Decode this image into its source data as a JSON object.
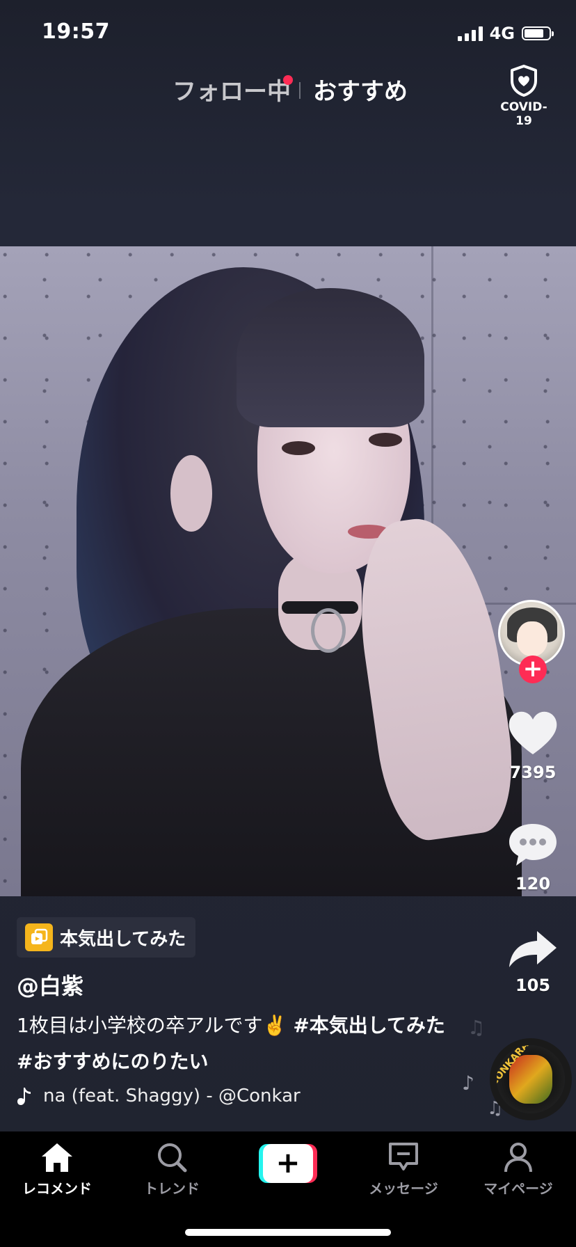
{
  "status_bar": {
    "time": "19:57",
    "network": "4G",
    "battery_level": 0.78
  },
  "top_tabs": {
    "following_label": "フォロー中",
    "foryou_label": "おすすめ",
    "following_has_new": true,
    "covid_label": "COVID-19"
  },
  "actions": {
    "likes": "7395",
    "comments": "120",
    "shares": "105"
  },
  "post": {
    "tag_chip_label": "本気出してみた",
    "username": "@白紫",
    "caption_text": "1枚目は小学校の卒アルです✌️ ",
    "hashtags": [
      "#本気出してみた",
      "#おすすめにのりたい"
    ],
    "music": "na (feat. Shaggy) - @Conkar",
    "disc_text": "CONKARAH"
  },
  "bottom_nav": {
    "items": [
      {
        "label": "レコメンド",
        "icon": "home-icon",
        "active": true
      },
      {
        "label": "トレンド",
        "icon": "search-icon",
        "active": false
      },
      {
        "label": "メッセージ",
        "icon": "message-icon",
        "active": false
      },
      {
        "label": "マイページ",
        "icon": "profile-icon",
        "active": false
      }
    ],
    "create_label": "+"
  },
  "colors": {
    "accent_red": "#fe2c55",
    "accent_cyan": "#25f4ee",
    "chip_icon": "#f5b51c",
    "background": "#1f2230"
  }
}
